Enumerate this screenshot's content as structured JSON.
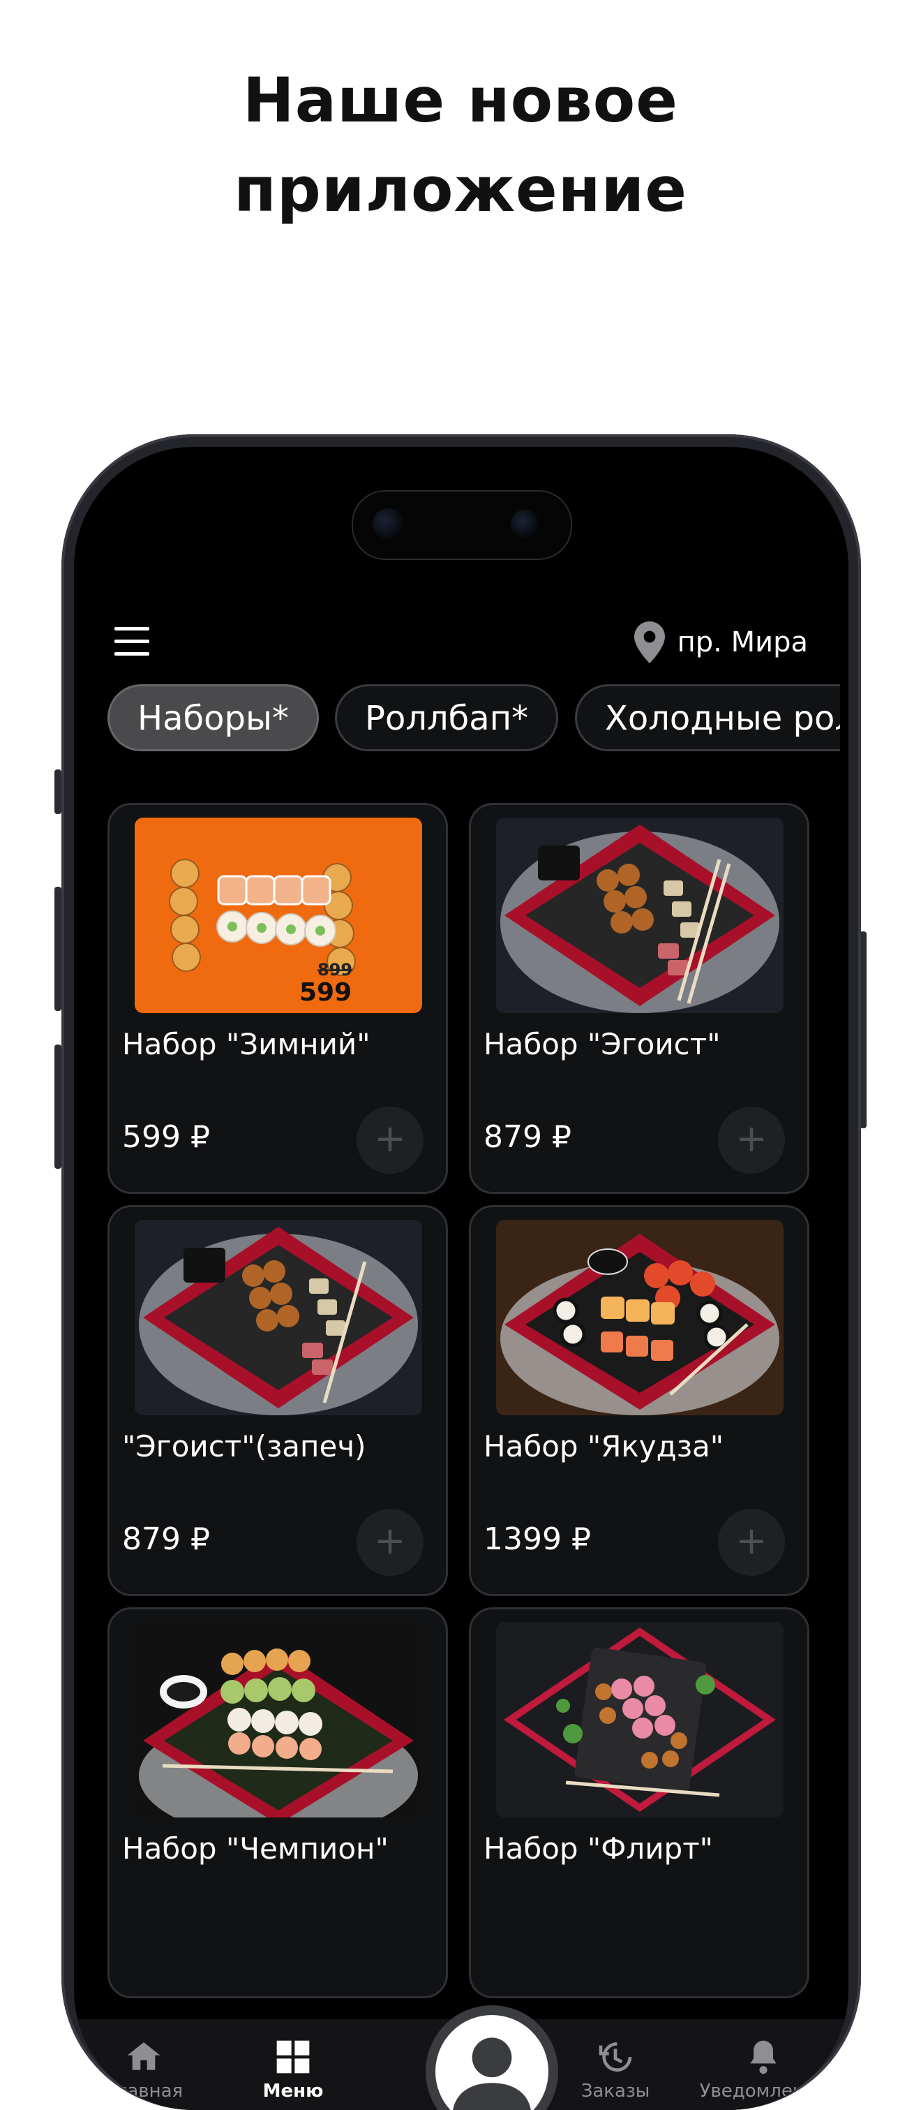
{
  "headline": {
    "line1": "Наше новое",
    "line2": "приложение"
  },
  "location": {
    "label": "пр. Мира",
    "icon": "map-pin-icon"
  },
  "chips": [
    {
      "label": "Наборы*",
      "active": true
    },
    {
      "label": "Роллбап*",
      "active": false
    },
    {
      "label": "Холодные роллы",
      "active": false
    }
  ],
  "products": [
    {
      "title": "Набор \"Зимний\"",
      "price": "599 ₽",
      "badge_old": "899",
      "badge_new": "599"
    },
    {
      "title": "Набор \"Эгоист\"",
      "price": "879 ₽"
    },
    {
      "title": "\"Эгоист\"(запеч)",
      "price": "879 ₽"
    },
    {
      "title": "Набор \"Якудза\"",
      "price": "1399 ₽"
    },
    {
      "title": "Набор \"Чемпион\""
    },
    {
      "title": "Набор \"Флирт\""
    }
  ],
  "add_label": "+",
  "tabs": [
    {
      "label": "Главная",
      "icon": "home-icon"
    },
    {
      "label": "Меню",
      "icon": "grid-icon",
      "active": true
    },
    {
      "label": "Заказы",
      "icon": "history-icon"
    },
    {
      "label": "Уведомления",
      "icon": "bell-icon"
    }
  ],
  "colors": {
    "screen": "#000000",
    "card": "#111214",
    "accent_chip": "#4a4a4c",
    "photo_orange": "#f06a10"
  }
}
